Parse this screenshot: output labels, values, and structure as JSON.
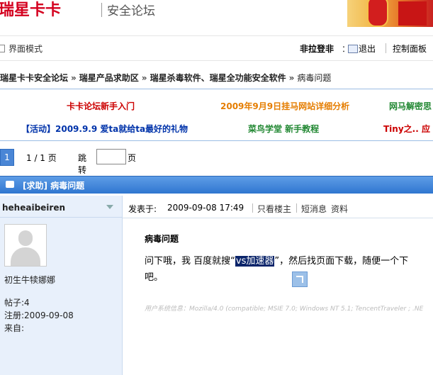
{
  "header": {
    "logo_text": "瑞星卡卡",
    "logo_sub": "安全论坛"
  },
  "userbar": {
    "mode_label": "界面模式",
    "username": "非拉登非",
    "colon": "：",
    "logout_label": "退出",
    "control_panel_label": "控制面板"
  },
  "breadcrumb": {
    "items": [
      "瑞星卡卡安全论坛",
      "瑞星产品求助区",
      "瑞星杀毒软件、瑞星全功能安全软件"
    ],
    "separator": "»",
    "current": "病毒问题"
  },
  "announcements": {
    "items": [
      {
        "text": "卡卡论坛新手入门",
        "color": "#cc0000"
      },
      {
        "text": "2009年9月9日挂马网站详细分析",
        "color": "#e57d00"
      },
      {
        "text": "网马解密思",
        "color": "#228833"
      },
      {
        "text": "【活动】2009.9.9 爱ta就给ta最好的礼物",
        "color": "#0033aa"
      },
      {
        "text": "菜鸟学堂 新手教程",
        "color": "#228833"
      },
      {
        "text": "Tiny之.. 应 较 t",
        "color": "#cc0000"
      }
    ]
  },
  "pager": {
    "current_page": "1",
    "page_info": "1 / 1 页",
    "jump_label": "跳转",
    "jump_value": "",
    "page_unit": "页"
  },
  "thread": {
    "title": "[求助] 病毒问题"
  },
  "post": {
    "author": "heheaibeiren",
    "rank": "初生牛犊娜娜",
    "posts_label": "帖子:",
    "posts_value": "4",
    "reg_label": "注册:",
    "reg_value": "2009-09-08",
    "from_label": "来自:",
    "from_value": "",
    "posted_label": "发表于:",
    "posted_time": "2009-09-08 17:49",
    "only_op": "只看楼主",
    "short_msg": "短消息",
    "profile": "资料",
    "title": "病毒问题",
    "body_before": "问下哦，我 百度就搜“",
    "body_highlight": "vs加速器",
    "body_after": "”，然后找页面下载，随便一个下",
    "body_line2": "吧。",
    "user_agent": "用户系统信息：Mozilla/4.0 (compatible; MSIE 7.0; Windows NT 5.1; TencentTraveler ; .NE"
  },
  "colors": {
    "logo_red": "#d4001f",
    "thread_blue": "#2f76d0",
    "author_bg": "#e8f0fb",
    "highlight": "#0a246a"
  }
}
